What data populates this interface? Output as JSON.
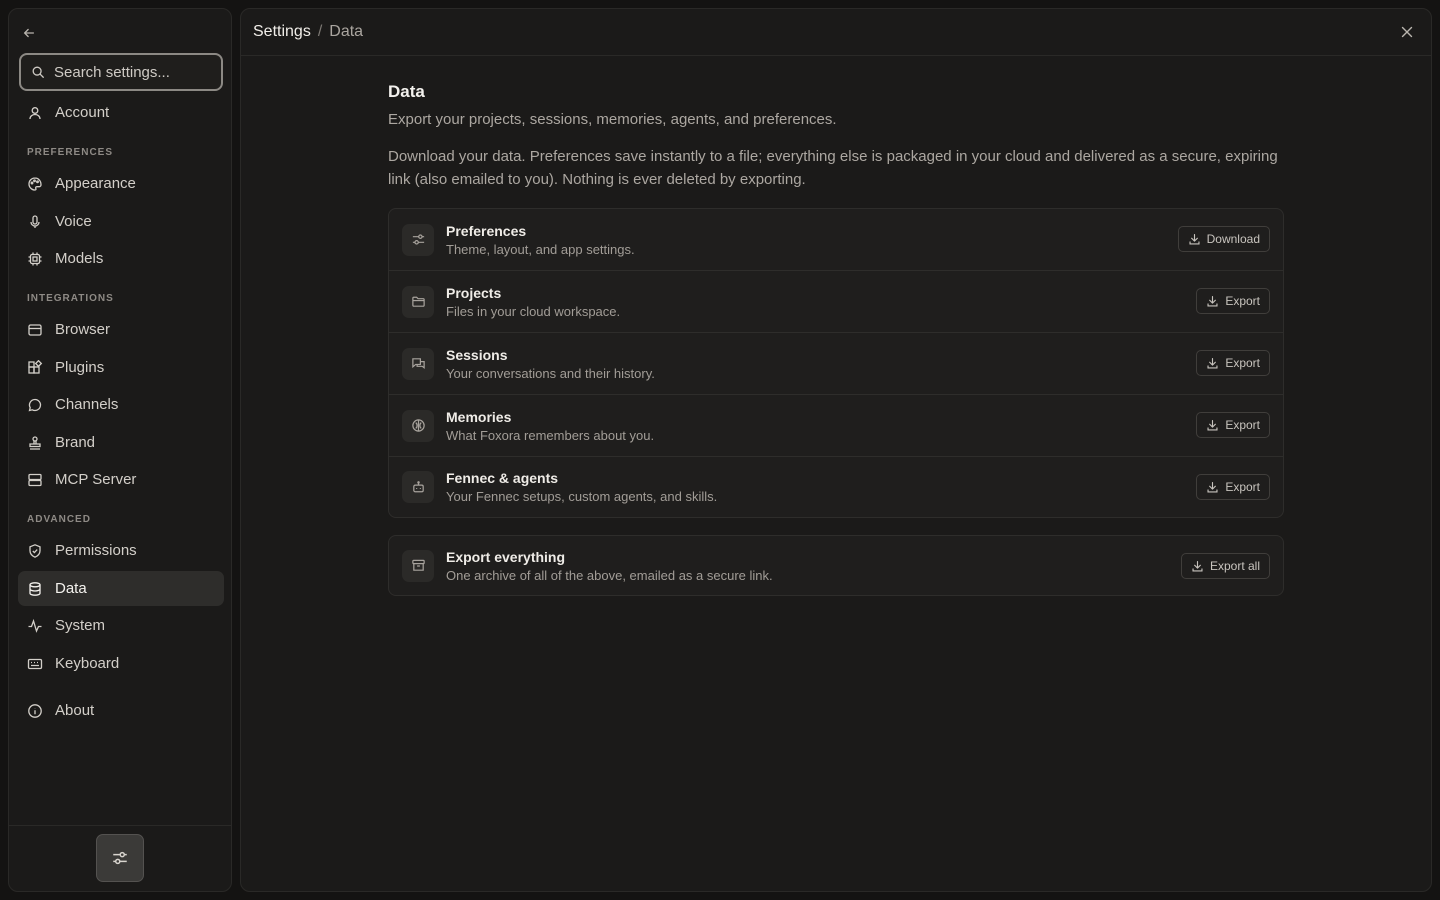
{
  "sidebar": {
    "search_placeholder": "Search settings...",
    "account": "Account",
    "sections": {
      "preferences": "PREFERENCES",
      "integrations": "INTEGRATIONS",
      "advanced": "ADVANCED"
    },
    "items": {
      "appearance": "Appearance",
      "voice": "Voice",
      "models": "Models",
      "browser": "Browser",
      "plugins": "Plugins",
      "channels": "Channels",
      "brand": "Brand",
      "mcp_server": "MCP Server",
      "permissions": "Permissions",
      "data": "Data",
      "system": "System",
      "keyboard": "Keyboard",
      "about": "About"
    },
    "active_item": "Data"
  },
  "header": {
    "breadcrumb_root": "Settings",
    "breadcrumb_sep": "/",
    "breadcrumb_current": "Data"
  },
  "main": {
    "title": "Data",
    "subtitle": "Export your projects, sessions, memories, agents, and preferences.",
    "description": "Download your data. Preferences save instantly to a file; everything else is packaged in your cloud and delivered as a secure, expiring link (also emailed to you). Nothing is ever deleted by exporting.",
    "rows": [
      {
        "icon": "sliders-icon",
        "title": "Preferences",
        "subtitle": "Theme, layout, and app settings.",
        "button": "Download"
      },
      {
        "icon": "folder-icon",
        "title": "Projects",
        "subtitle": "Files in your cloud workspace.",
        "button": "Export"
      },
      {
        "icon": "chat-icon",
        "title": "Sessions",
        "subtitle": "Your conversations and their history.",
        "button": "Export"
      },
      {
        "icon": "brain-icon",
        "title": "Memories",
        "subtitle": "What Foxora remembers about you.",
        "button": "Export"
      },
      {
        "icon": "bot-icon",
        "title": "Fennec & agents",
        "subtitle": "Your Fennec setups, custom agents, and skills.",
        "button": "Export"
      }
    ],
    "export_all": {
      "icon": "archive-icon",
      "title": "Export everything",
      "subtitle": "One archive of all of the above, emailed as a secure link.",
      "button": "Export all"
    }
  },
  "colors": {
    "background": "#141312",
    "panel": "#1b1a19",
    "active_item": "#2e2d2b"
  }
}
